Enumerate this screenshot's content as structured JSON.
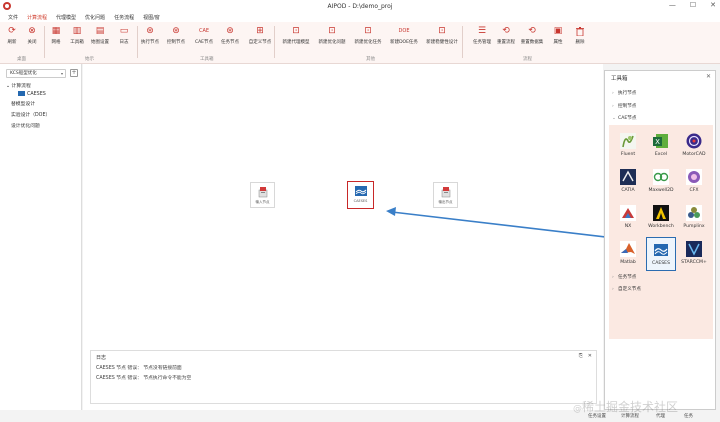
{
  "window": {
    "title": "AIPOD - D:\\demo_proj",
    "minimize": "—",
    "maximize": "☐",
    "close": "✕"
  },
  "menu": [
    "文件",
    "计算流程",
    "代理模型",
    "优化问题",
    "任务流程",
    "视图/窗"
  ],
  "menu_active_index": 1,
  "ribbon": {
    "buttons": [
      {
        "label": "刷新",
        "icon": "refresh-icon",
        "glyph": "⟳"
      },
      {
        "label": "关闭",
        "icon": "close-circle-icon",
        "glyph": "⊗"
      },
      {
        "label": "网格",
        "icon": "grid-icon",
        "glyph": "▦"
      },
      {
        "label": "工具箱",
        "icon": "toolbox-icon",
        "glyph": "▥"
      },
      {
        "label": "始图设置",
        "icon": "settings-icon",
        "glyph": "▤"
      },
      {
        "label": "日志",
        "icon": "log-icon",
        "glyph": "▭"
      },
      {
        "label": "执行节点",
        "icon": "execute-node-icon",
        "glyph": "⊛"
      },
      {
        "label": "控制节点",
        "icon": "control-node-icon",
        "glyph": "⊛"
      },
      {
        "label": "CAE节点",
        "icon": "cae-node-icon",
        "glyph": "CAE"
      },
      {
        "label": "任务节点",
        "icon": "task-node-icon",
        "glyph": "⊛"
      },
      {
        "label": "自定义节点",
        "icon": "custom-node-icon",
        "glyph": "⊞"
      },
      {
        "label": "新建代理模型",
        "icon": "new-surrogate-icon",
        "glyph": "⊡"
      },
      {
        "label": "新建优化问题",
        "icon": "new-optimization-icon",
        "glyph": "⊡"
      },
      {
        "label": "新建优化任务",
        "icon": "new-opt-task-icon",
        "glyph": "⊡"
      },
      {
        "label": "新建DOE任务",
        "icon": "new-doe-icon",
        "glyph": "DOE"
      },
      {
        "label": "新建稳健性设计",
        "icon": "new-robust-icon",
        "glyph": "⊡"
      },
      {
        "label": "任务管理",
        "icon": "task-manage-icon",
        "glyph": "☰"
      },
      {
        "label": "重置流程",
        "icon": "reset-flow-icon",
        "glyph": "⟲"
      },
      {
        "label": "重置数据集",
        "icon": "reset-dataset-icon",
        "glyph": "⟲"
      },
      {
        "label": "属性",
        "icon": "properties-icon",
        "glyph": "▣"
      },
      {
        "label": "删除",
        "icon": "delete-icon",
        "glyph": "🗑"
      }
    ],
    "groups": [
      "桌面",
      "始示",
      "工具箱",
      "其他",
      "流程"
    ]
  },
  "left_panel": {
    "project_select": "KCS船型优化",
    "add_button": "+",
    "tree": [
      {
        "label": "计算流程",
        "level": 1,
        "expanded": true
      },
      {
        "label": "CAESES",
        "level": 2
      },
      {
        "label": "替模型设计",
        "level": 0
      },
      {
        "label": "实验设计（DOE）",
        "level": 0
      },
      {
        "label": "设计优化问题",
        "level": 0
      }
    ]
  },
  "canvas": {
    "nodes": [
      {
        "label": "输入节点",
        "icon": "input-node-icon",
        "selected": false
      },
      {
        "label": "CAESES",
        "icon": "caeses-icon",
        "selected": true
      },
      {
        "label": "输出节点",
        "icon": "output-node-icon",
        "selected": false
      }
    ]
  },
  "log": {
    "title": "日志",
    "lines": [
      "CAESES 节点 错误：   节点没有链接前面",
      "CAESES 节点 错误：   节点执行命令不能为空"
    ],
    "controls": [
      "⎘",
      "✕"
    ]
  },
  "status_tabs": [
    "任务设置",
    "计算流程",
    "代理",
    "任务"
  ],
  "toolbox": {
    "title": "工具箱",
    "close": "✕",
    "categories_top": [
      "执行节点",
      "控制节点",
      "CAE节点"
    ],
    "categories_bottom": [
      "任务节点",
      "自定义节点"
    ],
    "tools": [
      {
        "label": "Fluent",
        "icon": "fluent-icon"
      },
      {
        "label": "Excel",
        "icon": "excel-icon"
      },
      {
        "label": "MotorCAD",
        "icon": "motorcad-icon"
      },
      {
        "label": "CATIA",
        "icon": "catia-icon"
      },
      {
        "label": "Maxwell2D",
        "icon": "maxwell2d-icon"
      },
      {
        "label": "CFX",
        "icon": "cfx-icon"
      },
      {
        "label": "NX",
        "icon": "nx-icon"
      },
      {
        "label": "Workbench",
        "icon": "workbench-icon"
      },
      {
        "label": "Pumplinx",
        "icon": "pumplinx-icon"
      },
      {
        "label": "Matlab",
        "icon": "matlab-icon"
      },
      {
        "label": "CAESES",
        "icon": "caeses-icon",
        "selected": true
      },
      {
        "label": "STARCCM+",
        "icon": "starccm-icon"
      }
    ]
  },
  "watermark": {
    "prefix": "@",
    "text": "稀土掘金技术社区"
  },
  "colors": {
    "accent": "#c8362f",
    "ribbon_bg": "#fdf5f3",
    "toolbox_grid_bg": "#fbe9e2",
    "selection_blue": "#2b6cb0",
    "arrow_blue": "#3a7fc8"
  }
}
